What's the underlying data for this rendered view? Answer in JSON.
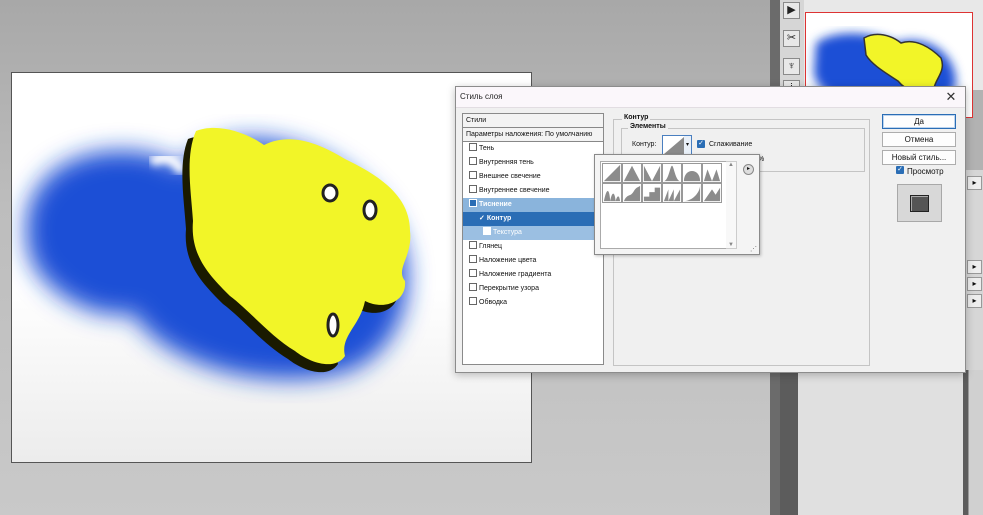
{
  "dialog": {
    "title": "Стиль слоя",
    "close_glyph": "✕"
  },
  "styles_list": {
    "header": "Стили",
    "blending_options": "Параметры наложения: По умолчанию",
    "items": [
      {
        "label": "Тень",
        "checked": false
      },
      {
        "label": "Внутренняя тень",
        "checked": false
      },
      {
        "label": "Внешнее свечение",
        "checked": false
      },
      {
        "label": "Внутреннее свечение",
        "checked": false
      },
      {
        "label": "Тиснение",
        "checked": true,
        "selected": true
      },
      {
        "label": "Контур",
        "checked": true,
        "active_sub": true
      },
      {
        "label": "Текстура",
        "checked": false,
        "sub": true
      },
      {
        "label": "Глянец",
        "checked": false
      },
      {
        "label": "Наложение цвета",
        "checked": false
      },
      {
        "label": "Наложение градиента",
        "checked": false
      },
      {
        "label": "Перекрытие узора",
        "checked": false
      },
      {
        "label": "Обводка",
        "checked": false
      }
    ]
  },
  "contour_section": {
    "group_title": "Контур",
    "elements_title": "Элементы",
    "contour_label": "Контур:",
    "smoothing_label": "Сглаживание",
    "smoothing_checked": true,
    "range_suffix": "%"
  },
  "buttons": {
    "ok": "Да",
    "cancel": "Отмена",
    "new_style": "Новый стиль...",
    "preview_label": "Просмотр",
    "preview_checked": true
  },
  "picker": {
    "menu_glyph": "▸",
    "grip_glyph": "⋰",
    "presets": [
      "linear",
      "cone",
      "cone-inverted",
      "gaussian",
      "half-round",
      "ring",
      "ring-double",
      "rolling-slope",
      "rounded-steps",
      "sawtooth",
      "cove-deep",
      "cove-shallow"
    ]
  },
  "colors": {
    "accent": "#2a6db5",
    "shape_yellow": "#f2f528",
    "shape_blue": "#1f4fd6"
  }
}
